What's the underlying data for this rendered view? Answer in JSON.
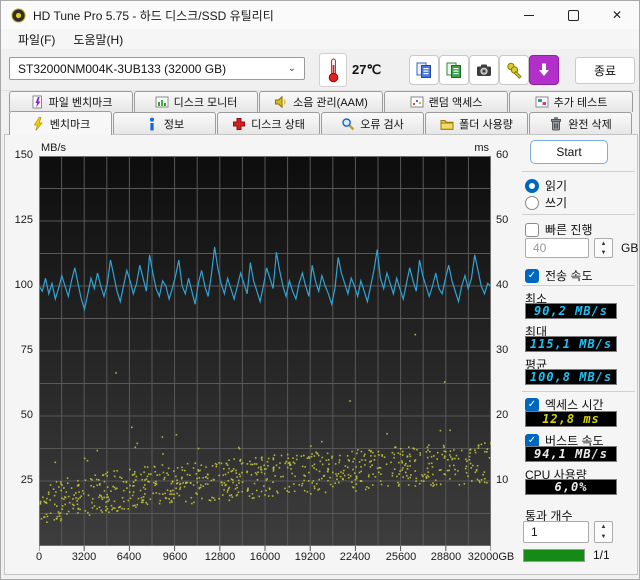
{
  "window": {
    "title": "HD Tune Pro 5.75 - 하드 디스크/SSD 유틸리티",
    "controls": {
      "minimize": "minimize",
      "maximize": "maximize",
      "close": "close"
    }
  },
  "menu": {
    "file": "파일(F)",
    "help": "도움말(H)"
  },
  "toolbar": {
    "drive_selector": "ST32000NM004K-3UB133 (32000 GB)",
    "temperature": "27℃",
    "icon_buttons": [
      "copy-pages-blue-icon",
      "copy-pages-green-icon",
      "camera-icon",
      "keys-icon",
      "update-download-icon"
    ],
    "exit_label": "종료"
  },
  "tabs": {
    "row1": [
      {
        "id": "file-benchmark",
        "label": "파일 벤치마크"
      },
      {
        "id": "disk-monitor",
        "label": "디스크 모니터"
      },
      {
        "id": "aam",
        "label": "소음 관리(AAM)"
      },
      {
        "id": "random-access",
        "label": "랜덤 액세스"
      },
      {
        "id": "extra-tests",
        "label": "추가 테스트"
      }
    ],
    "row2": [
      {
        "id": "benchmark",
        "label": "벤치마크",
        "active": true
      },
      {
        "id": "info",
        "label": "정보"
      },
      {
        "id": "health",
        "label": "디스크 상태"
      },
      {
        "id": "error-scan",
        "label": "오류 검사"
      },
      {
        "id": "folder-usage",
        "label": "폴더 사용량"
      },
      {
        "id": "secure-erase",
        "label": "완전 삭제"
      }
    ]
  },
  "panel": {
    "start_label": "Start",
    "read_label": "읽기",
    "write_label": "쓰기",
    "quick_label": "빠른 진행",
    "quick_value": "40",
    "quick_unit": "GB",
    "transfer_label": "전송 속도",
    "min_label": "최소",
    "min_value": "90,2 MB/s",
    "max_label": "최대",
    "max_value": "115,1 MB/s",
    "avg_label": "평균",
    "avg_value": "100,8 MB/s",
    "access_label": "엑세스 시간",
    "access_value": "12,8 ms",
    "burst_label": "버스트 속도",
    "burst_value": "94,1 MB/s",
    "cpu_label": "CPU 사용량",
    "cpu_value": "6,0%",
    "pass_label": "통과 개수",
    "pass_value": "1",
    "progress_label": "1/1"
  },
  "colors": {
    "accent": "#0067c0",
    "lcd_cyan": "#1ec2f2",
    "lcd_yellow": "#d8d800",
    "lcd_white": "#ededed",
    "progress_green": "#168a16",
    "update_purple": "#b32fc9",
    "transfer_line": "#2fa3d6",
    "access_dots": "#c2c438"
  },
  "chart_data": {
    "type": "line",
    "title": "HD Tune 벤치마크 — 전송 속도(선) / 엑세스 시간(점)",
    "x": {
      "min": 0,
      "max": 32000,
      "unit": "GB",
      "ticks": [
        "0",
        "3200",
        "6400",
        "9600",
        "12800",
        "16000",
        "19200",
        "22400",
        "25600",
        "28800",
        "32000GB"
      ]
    },
    "y_left": {
      "label": "MB/s",
      "min": 0,
      "max": 150,
      "ticks": [
        150,
        125,
        100,
        75,
        50,
        25
      ]
    },
    "y_right": {
      "label": "ms",
      "min": 0,
      "max": 60,
      "ticks": [
        60,
        50,
        40,
        30,
        20,
        10
      ]
    },
    "grid": {
      "v_divisions": 20,
      "h_divisions": 12,
      "color": "#585858",
      "bg_top": "#0d0d0d",
      "bg_bottom": "#3d3d3d"
    },
    "legend_position": "none",
    "series": [
      {
        "name": "transfer-rate",
        "kind": "line",
        "color": "#2fa3d6",
        "unit": "MB/s",
        "min": 90.2,
        "max": 115.1,
        "avg": 100.8,
        "points": [
          100,
          98,
          103,
          97,
          101,
          95,
          99,
          104,
          100,
          96,
          102,
          107,
          101,
          95,
          91,
          97,
          103,
          99,
          105,
          100,
          96,
          101,
          110,
          104,
          98,
          94,
          100,
          106,
          102,
          97,
          101,
          108,
          103,
          98,
          112,
          105,
          99,
          96,
          102,
          100,
          95,
          99,
          104,
          110,
          100,
          97,
          103,
          98,
          93,
          101,
          106,
          100,
          96,
          104,
          115,
          107,
          101,
          97,
          103,
          99,
          95,
          100,
          105,
          101,
          97,
          109,
          102,
          98,
          94,
          100,
          107,
          103,
          99,
          113,
          106,
          100,
          96,
          102,
          98,
          95,
          101,
          105,
          100,
          96,
          108,
          102,
          98,
          104,
          100,
          97,
          93,
          99,
          111,
          105,
          101,
          97,
          103,
          100,
          96,
          102,
          98,
          94,
          100,
          106,
          114,
          103,
          99,
          105,
          101,
          97,
          103,
          99,
          95,
          101,
          107,
          102,
          98,
          110,
          104,
          100,
          96,
          100,
          105,
          99,
          97,
          103,
          108,
          102,
          98,
          94,
          100,
          104,
          99,
          103,
          112,
          106,
          100,
          97,
          101,
          100
        ]
      },
      {
        "name": "access-time",
        "kind": "scatter",
        "color": "#c2c438",
        "unit": "ms",
        "avg": 12.8,
        "scatter": {
          "count": 800,
          "seed": 12,
          "start_ms": 5.5,
          "end_ms": 13,
          "spread_ms": 3.2,
          "curve_exp": 0.5,
          "outlier_prob": 0.03,
          "outlier_extra_ms": 10,
          "rare_prob": 0.004,
          "rare_extra_ms": 40
        }
      }
    ]
  }
}
